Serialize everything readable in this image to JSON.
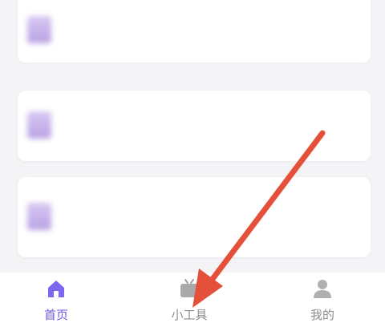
{
  "list": {
    "items": [
      {
        "title": "",
        "meta": ""
      },
      {
        "title": "",
        "meta": ""
      },
      {
        "title": "",
        "meta": ""
      }
    ]
  },
  "tabbar": {
    "tabs": [
      {
        "label": "首页",
        "icon": "home-icon",
        "active": true
      },
      {
        "label": "小工具",
        "icon": "toolbox-icon",
        "active": false
      },
      {
        "label": "我的",
        "icon": "profile-icon",
        "active": false
      }
    ]
  },
  "colors": {
    "active": "#6a5ae0",
    "inactive": "#8c8c8c",
    "arrow": "#e4503a"
  }
}
